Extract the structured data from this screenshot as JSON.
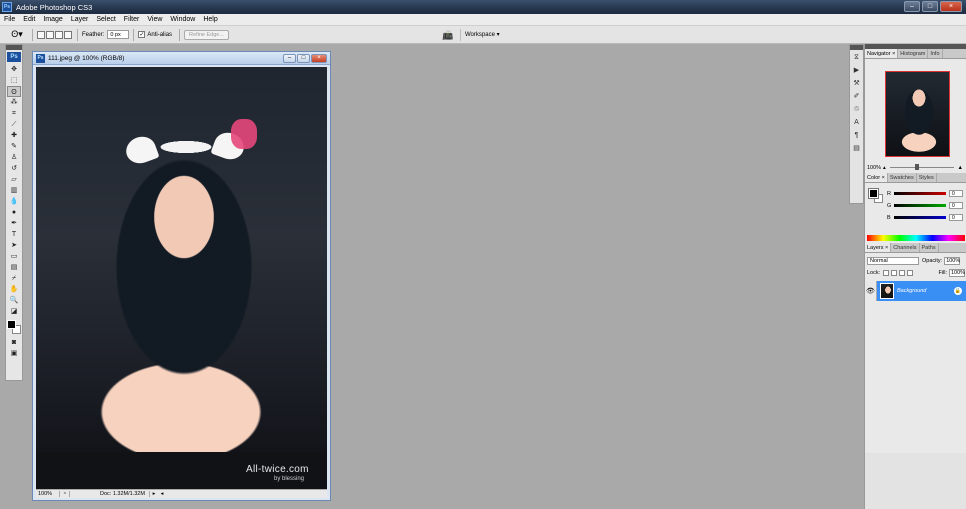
{
  "window": {
    "title": "Adobe Photoshop CS3",
    "app_icon": "Ps"
  },
  "menu": [
    "File",
    "Edit",
    "Image",
    "Layer",
    "Select",
    "Filter",
    "View",
    "Window",
    "Help"
  ],
  "options": {
    "feather_label": "Feather:",
    "feather_value": "0 px",
    "antialias_label": "Anti-alias",
    "antialias_checked": "✓",
    "refine_label": "Refine Edge...",
    "workspace_label": "Workspace ▾"
  },
  "tools": {
    "logo": "Ps"
  },
  "document": {
    "title": "111.jpeg @ 100% (RGB/8)",
    "icon": "Ps",
    "watermark": "All-twice.com",
    "watermark_sub": "by blessing",
    "zoom": "100%",
    "doc_info": "Doc: 1.32M/1.32M"
  },
  "navigator": {
    "tabs": [
      "Navigator ×",
      "Histogram",
      "Info"
    ],
    "zoom": "100%"
  },
  "color": {
    "tabs": [
      "Color ×",
      "Swatches",
      "Styles"
    ],
    "r_label": "R",
    "r_value": "0",
    "g_label": "G",
    "g_value": "0",
    "b_label": "B",
    "b_value": "0",
    "colors": {
      "r": "#cc0000",
      "g": "#00aa00",
      "b": "#0000cc"
    }
  },
  "layers": {
    "tabs": [
      "Layers ×",
      "Channels",
      "Paths"
    ],
    "blend_mode": "Normal",
    "opacity_label": "Opacity:",
    "opacity_value": "100%",
    "lock_label": "Lock:",
    "fill_label": "Fill:",
    "fill_value": "100%",
    "items": [
      {
        "name": "Background"
      }
    ]
  }
}
